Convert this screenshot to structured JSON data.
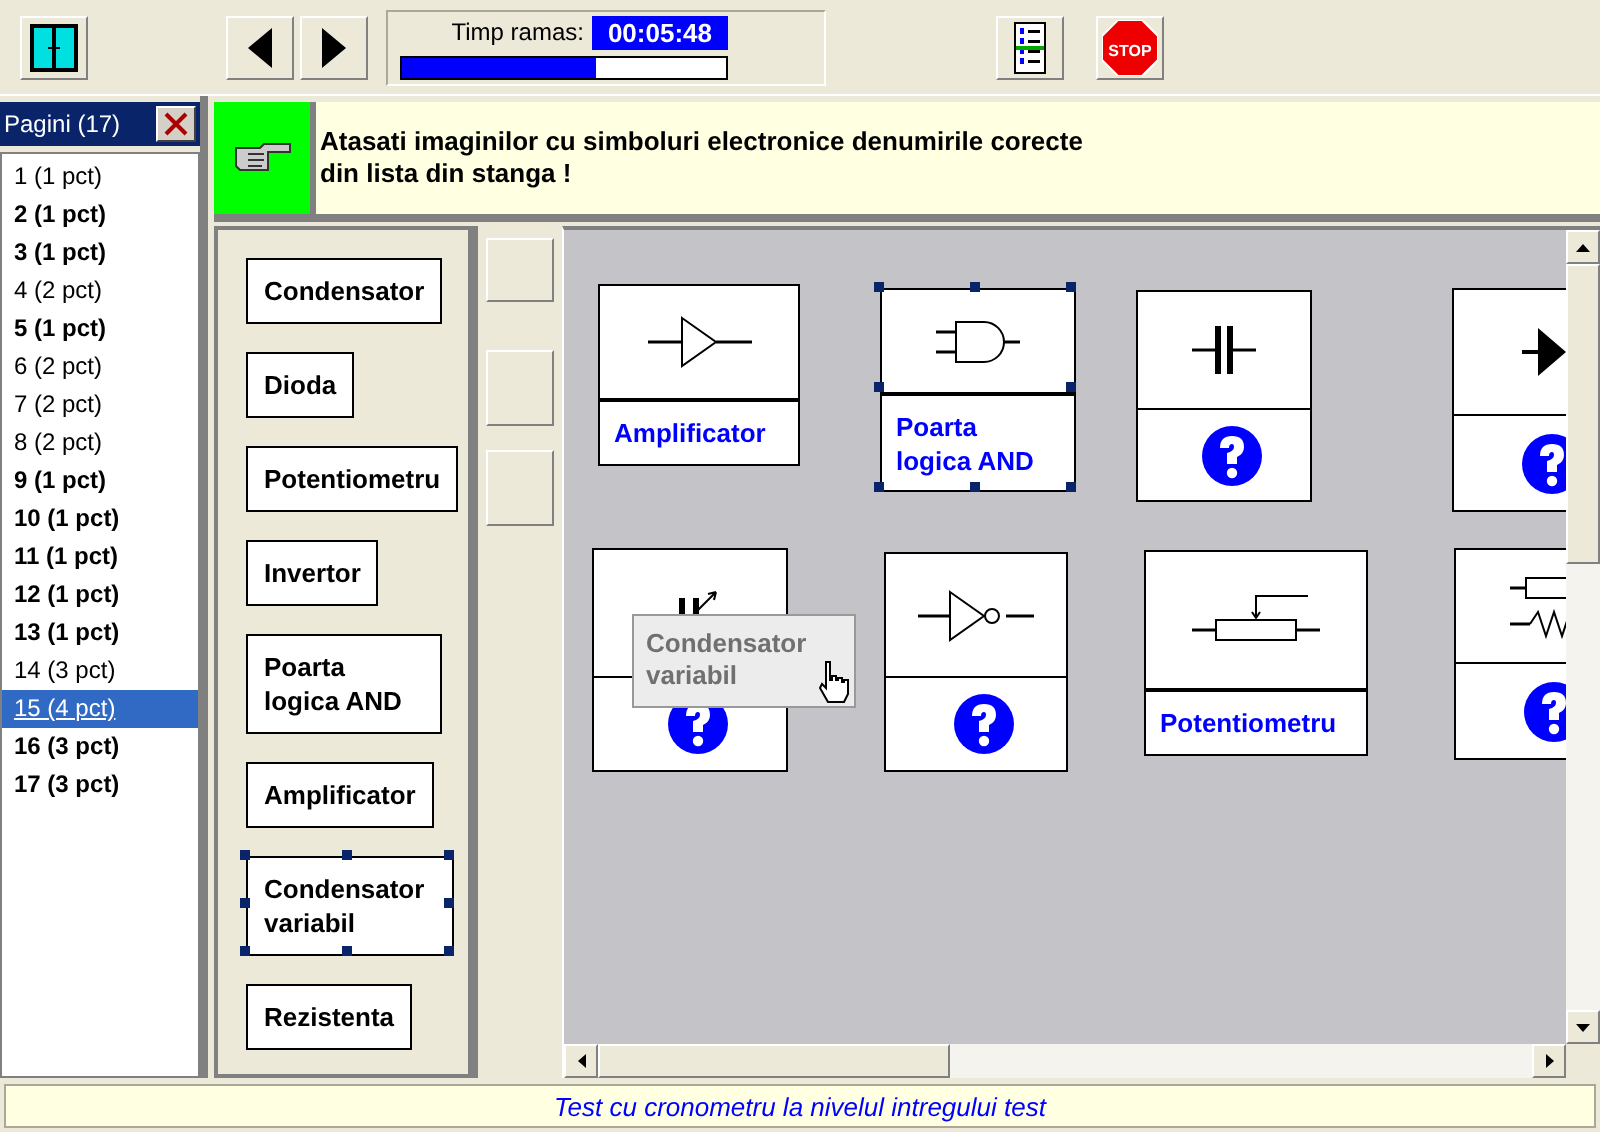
{
  "toolbar": {
    "timer_label": "Timp ramas:",
    "timer_value": "00:05:48",
    "timer": {
      "level": 0.6
    },
    "stop_label": "STOP"
  },
  "sidebar": {
    "title": "Pagini (17)",
    "items": [
      {
        "label": "1 (1 pct)",
        "bold": false,
        "selected": false
      },
      {
        "label": "2 (1 pct)",
        "bold": true,
        "selected": false
      },
      {
        "label": "3 (1 pct)",
        "bold": true,
        "selected": false
      },
      {
        "label": "4 (2 pct)",
        "bold": false,
        "selected": false
      },
      {
        "label": "5 (1 pct)",
        "bold": true,
        "selected": false
      },
      {
        "label": "6 (2 pct)",
        "bold": false,
        "selected": false
      },
      {
        "label": "7 (2 pct)",
        "bold": false,
        "selected": false
      },
      {
        "label": "8 (2 pct)",
        "bold": false,
        "selected": false
      },
      {
        "label": "9 (1 pct)",
        "bold": true,
        "selected": false
      },
      {
        "label": "10 (1 pct)",
        "bold": true,
        "selected": false
      },
      {
        "label": "11 (1 pct)",
        "bold": true,
        "selected": false
      },
      {
        "label": "12 (1 pct)",
        "bold": true,
        "selected": false
      },
      {
        "label": "13 (1 pct)",
        "bold": true,
        "selected": false
      },
      {
        "label": "14 (3 pct)",
        "bold": false,
        "selected": false
      },
      {
        "label": "15 (4 pct)",
        "bold": false,
        "selected": true
      },
      {
        "label": "16 (3 pct)",
        "bold": true,
        "selected": false
      },
      {
        "label": "17 (3 pct)",
        "bold": true,
        "selected": false
      }
    ]
  },
  "instruction": {
    "lines": [
      "Atasati imaginilor cu simboluri electronice denumirile corecte",
      "din lista din stanga !"
    ]
  },
  "word_list": [
    {
      "label": "Condensator",
      "selected": false
    },
    {
      "label": "Dioda",
      "selected": false
    },
    {
      "label": "Potentiometru",
      "selected": false
    },
    {
      "label": "Invertor",
      "selected": false
    },
    {
      "label": "Poarta logica AND",
      "selected": false
    },
    {
      "label": "Amplificator",
      "selected": false
    },
    {
      "label": "Condensator variabil",
      "selected": true
    },
    {
      "label": "Rezistenta",
      "selected": false
    }
  ],
  "cards": [
    {
      "kind": "amplifier",
      "answer": "Amplificator",
      "selected": false
    },
    {
      "kind": "and",
      "answer": "Poarta logica AND",
      "selected": true
    },
    {
      "kind": "capacitor",
      "selected": false
    },
    {
      "kind": "diode",
      "selected": false
    },
    {
      "kind": "varcap",
      "selected": false
    },
    {
      "kind": "inverter",
      "selected": false
    },
    {
      "kind": "potentiometer",
      "answer": "Potentiometru",
      "selected": false
    },
    {
      "kind": "resistor",
      "selected": false
    }
  ],
  "drag_label": {
    "text": "Condensator variabil"
  },
  "status_bar": {
    "text": "Test cu cronometru la nivelul intregului test"
  }
}
